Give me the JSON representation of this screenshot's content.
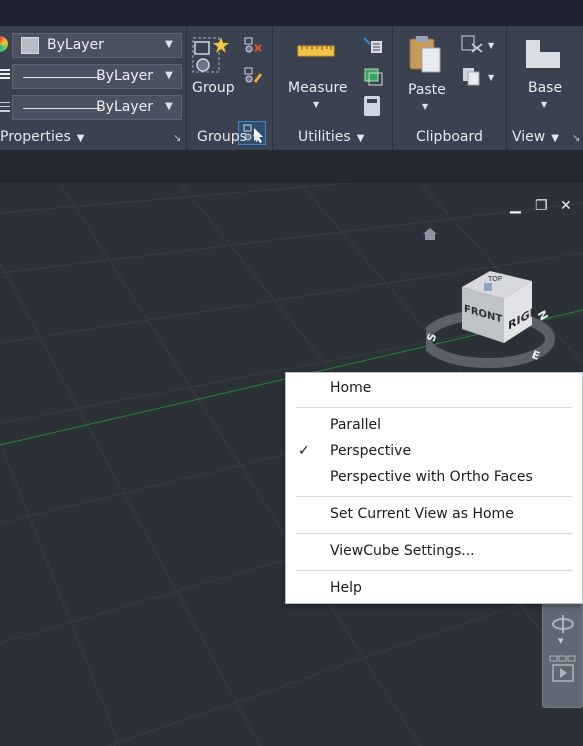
{
  "ribbon": {
    "properties": {
      "color_value": "ByLayer",
      "linetype_value": "ByLayer",
      "lineweight_value": "ByLayer",
      "title": "Properties"
    },
    "groups": {
      "group_label": "Group",
      "title": "Groups"
    },
    "utilities": {
      "measure_label": "Measure",
      "title": "Utilities"
    },
    "clipboard": {
      "paste_label": "Paste",
      "title": "Clipboard"
    },
    "view": {
      "base_label": "Base",
      "title": "View"
    }
  },
  "viewcube": {
    "faces": {
      "front": "FRONT",
      "right": "RIGHT",
      "top": "TOP"
    },
    "compass": {
      "s": "S",
      "e": "E",
      "n": "N"
    }
  },
  "context_menu": {
    "items": [
      {
        "label": "Home"
      },
      {
        "label": "Parallel"
      },
      {
        "label": "Perspective",
        "checked": true
      },
      {
        "label": "Perspective with Ortho Faces"
      },
      {
        "label": "Set Current View as Home"
      },
      {
        "label": "ViewCube Settings..."
      },
      {
        "label": "Help"
      }
    ]
  },
  "colors": {
    "ribbon_bg": "#3a4250",
    "viewport_bg": "#2c3038",
    "grid_line": "#3a3f47",
    "axis_green": "#1e8a2f",
    "highlight_blue": "#3f86c9"
  }
}
